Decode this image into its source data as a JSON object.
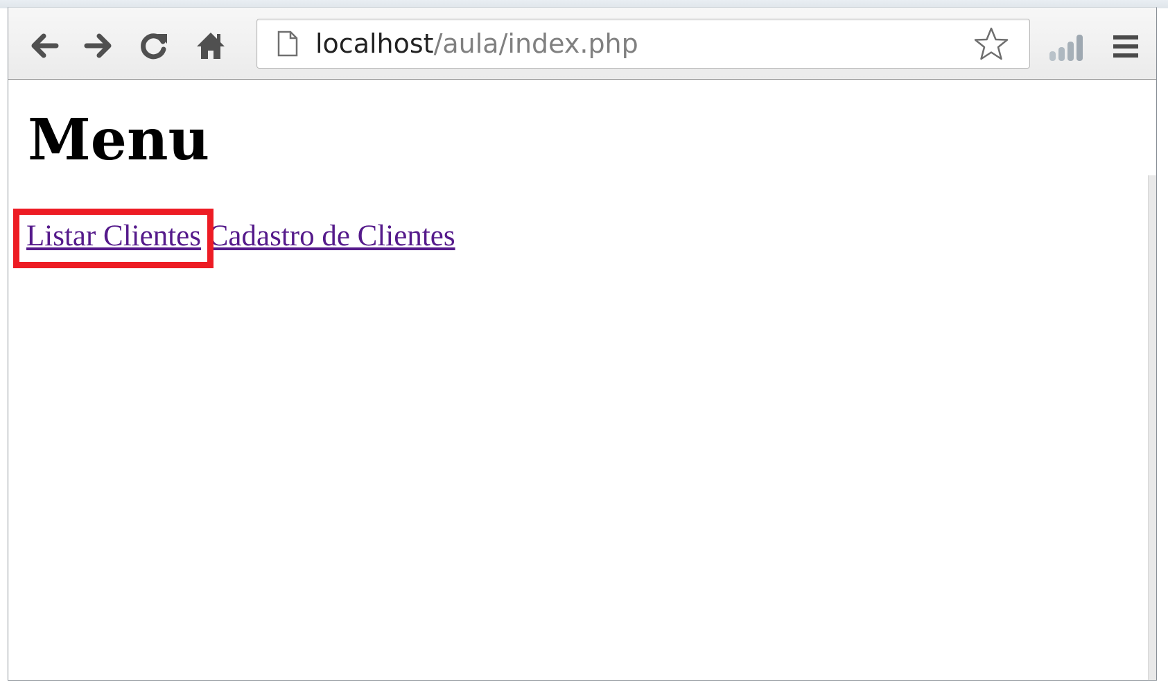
{
  "browser": {
    "address_bar": {
      "host": "localhost",
      "path": "/aula/index.php"
    },
    "icons": {
      "back": "back-arrow-icon",
      "forward": "forward-arrow-icon",
      "reload": "reload-icon",
      "home": "home-icon",
      "page": "page-icon",
      "bookmark": "star-icon",
      "signal": "signal-bars-icon",
      "menu": "hamburger-menu-icon"
    }
  },
  "page": {
    "title": "Menu",
    "links": [
      {
        "label": "Listar Clientes"
      },
      {
        "label": "Cadastro de Clientes"
      }
    ],
    "visited_link_color": "#551a8b",
    "highlight_color": "#ed1c24"
  }
}
